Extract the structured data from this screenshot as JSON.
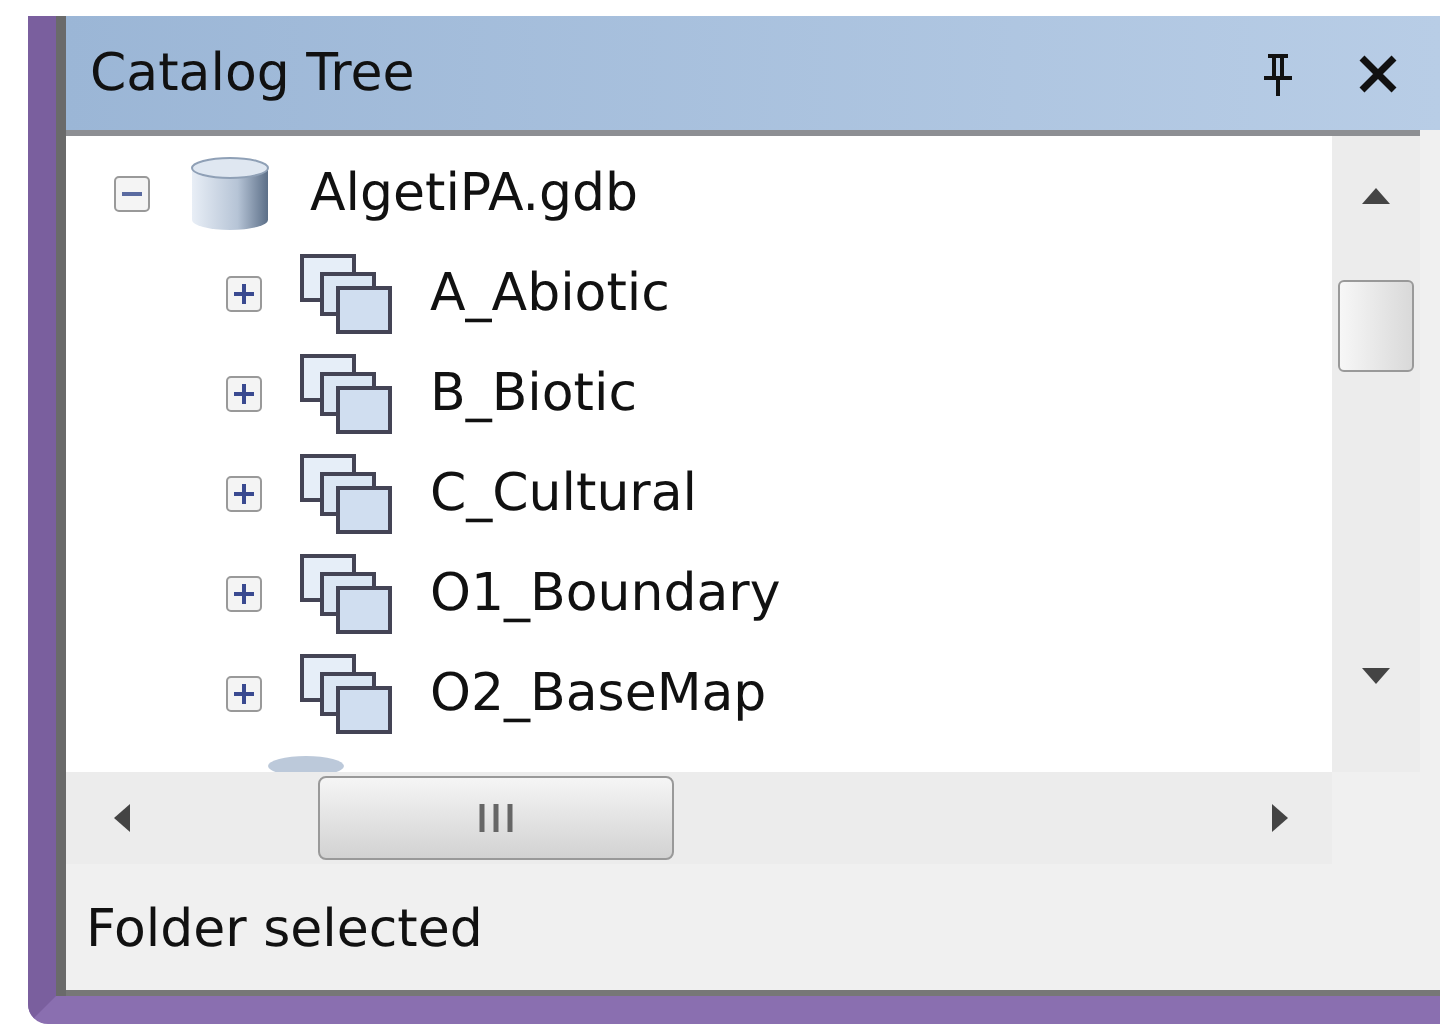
{
  "panel": {
    "title": "Catalog Tree"
  },
  "tree": [
    {
      "label": "AlgetiPA.gdb",
      "kind": "geodatabase",
      "expanded": true,
      "children": [
        {
          "label": "A_Abiotic",
          "kind": "dataset",
          "expanded": false
        },
        {
          "label": "B_Biotic",
          "kind": "dataset",
          "expanded": false
        },
        {
          "label": "C_Cultural",
          "kind": "dataset",
          "expanded": false
        },
        {
          "label": "O1_Boundary",
          "kind": "dataset",
          "expanded": false
        },
        {
          "label": "O2_BaseMap",
          "kind": "dataset",
          "expanded": false
        }
      ]
    }
  ],
  "status_bar": "Folder selected"
}
